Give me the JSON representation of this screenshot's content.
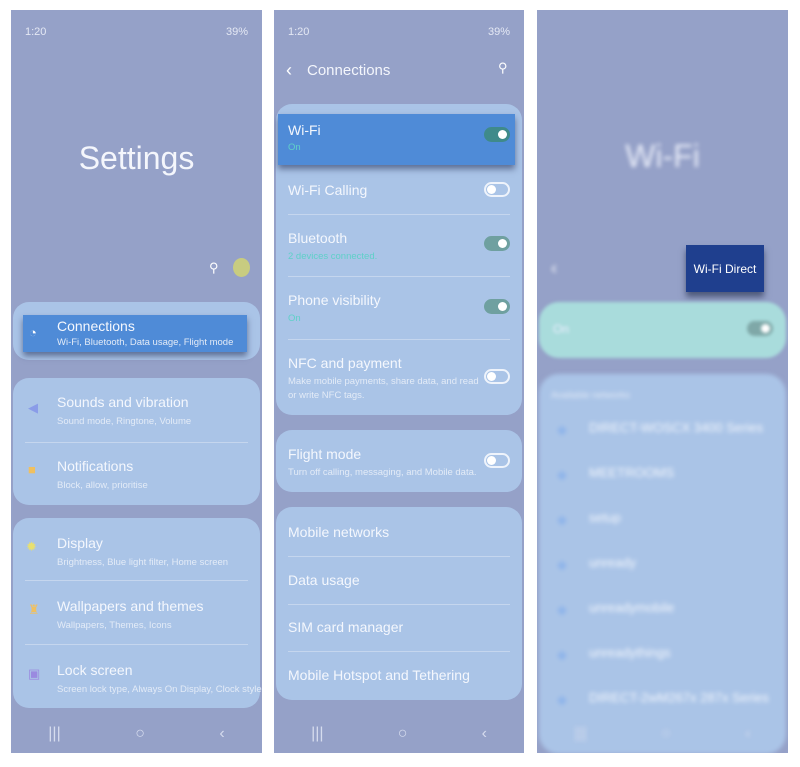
{
  "panel1": {
    "status_time": "1:20",
    "status_right": "39%",
    "title": "Settings",
    "items": [
      {
        "label": "Connections",
        "sub": "Wi-Fi, Bluetooth, Data usage, Flight mode"
      },
      {
        "label": "Sounds and vibration",
        "sub": "Sound mode, Ringtone, Volume"
      },
      {
        "label": "Notifications",
        "sub": "Block, allow, prioritise"
      },
      {
        "label": "Display",
        "sub": "Brightness, Blue light filter, Home screen"
      },
      {
        "label": "Wallpapers and themes",
        "sub": "Wallpapers, Themes, Icons"
      },
      {
        "label": "Lock screen",
        "sub": "Screen lock type, Always On Display, Clock style"
      }
    ]
  },
  "panel2": {
    "status_time": "1:20",
    "status_right": "39%",
    "title": "Connections",
    "items": [
      {
        "label": "Wi-Fi",
        "sub": "On",
        "toggle": true
      },
      {
        "label": "Wi-Fi Calling",
        "toggle": false
      },
      {
        "label": "Bluetooth",
        "sub": "2 devices connected.",
        "toggle": true
      },
      {
        "label": "Phone visibility",
        "sub": "On",
        "toggle": true
      },
      {
        "label": "NFC and payment",
        "sub": "Make mobile payments, share data, and read",
        "sub2": "or write NFC tags.",
        "toggle": false
      },
      {
        "label": "Flight mode",
        "sub": "Turn off calling, messaging, and Mobile data.",
        "toggle": false
      },
      {
        "label": "Mobile networks"
      },
      {
        "label": "Data usage"
      },
      {
        "label": "SIM card manager"
      },
      {
        "label": "Mobile Hotspot and Tethering"
      }
    ]
  },
  "panel3": {
    "title": "Wi-Fi",
    "wifi_direct": "Wi-Fi Direct",
    "on_label": "On",
    "toggle": true,
    "section": "Available networks",
    "networks": [
      "DIRECT-WOSCX 3400 Series",
      "MEETROOMS",
      "setup",
      "unready",
      "unreadymobile",
      "unreadythings",
      "DIRECT-2wM267x 287x Series"
    ]
  },
  "colors": {
    "panel_bg": "#95a1c8",
    "card": "#aac4e7",
    "highlight": "#4f8bd7",
    "wifi_direct": "#1f3f8e",
    "on_row": "#a9dcdc"
  }
}
